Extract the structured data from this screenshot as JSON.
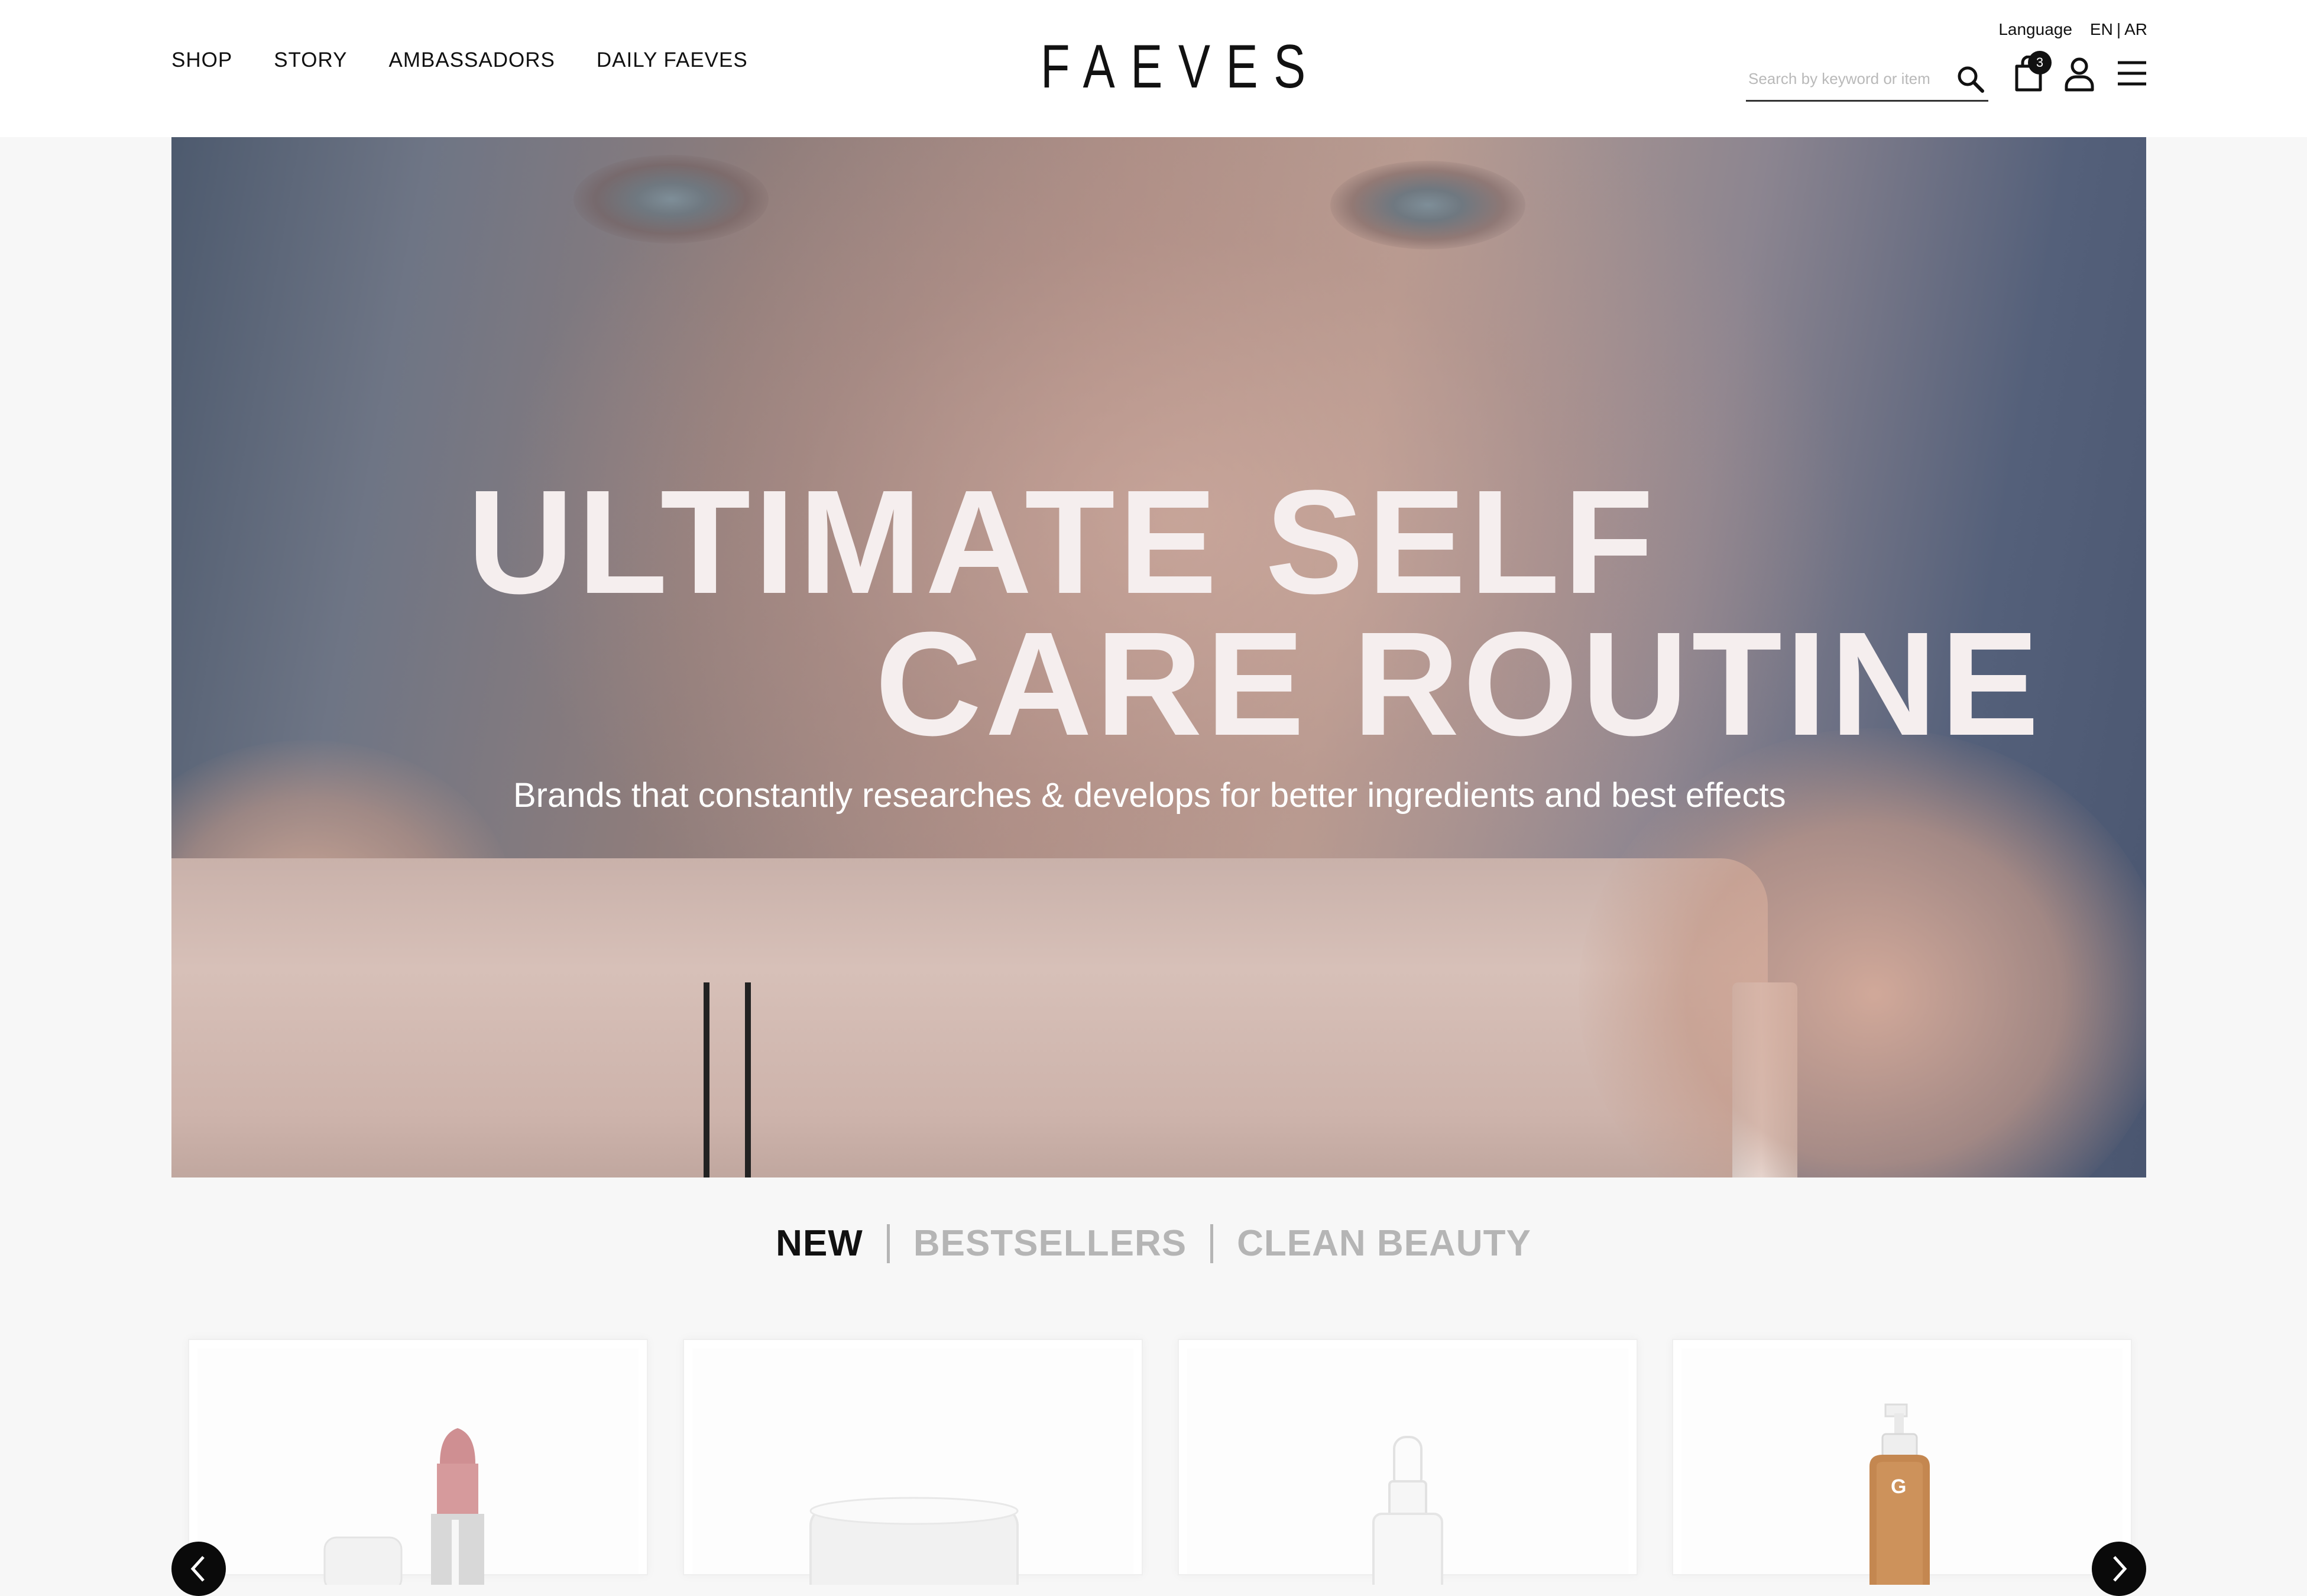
{
  "nav": {
    "items": [
      "SHOP",
      "STORY",
      "AMBASSADORS",
      "DAILY FAEVES"
    ]
  },
  "brand": {
    "logo": "FAEVES"
  },
  "language": {
    "label": "Language",
    "options": [
      "EN",
      "|",
      "AR"
    ]
  },
  "search": {
    "placeholder": "Search by keyword or item",
    "value": "",
    "icon": "search-icon"
  },
  "cart": {
    "count": "3",
    "icon": "shopping-bag-icon"
  },
  "account": {
    "icon": "user-icon"
  },
  "menu": {
    "icon": "hamburger-menu-icon"
  },
  "hero": {
    "headline_line1": "ULTIMATE SELF",
    "headline_line2": "CARE ROUTINE",
    "subtitle": "Brands that constantly researches & develops for better ingredients and best effects"
  },
  "product_tabs": {
    "items": [
      "NEW",
      "BESTSELLERS",
      "CLEAN BEAUTY"
    ],
    "active": "NEW"
  },
  "products": [
    {
      "image": "lipstick-product-image"
    },
    {
      "image": "cream-jar-product-image"
    },
    {
      "image": "dropper-serum-product-image"
    },
    {
      "image": "pump-bottle-product-image"
    }
  ],
  "carousel": {
    "prev_icon": "chevron-left-icon",
    "next_icon": "chevron-right-icon"
  },
  "colors": {
    "accent": "#111111",
    "tab_inactive": "#b5b5b5",
    "page_bg": "#f7f7f7"
  }
}
